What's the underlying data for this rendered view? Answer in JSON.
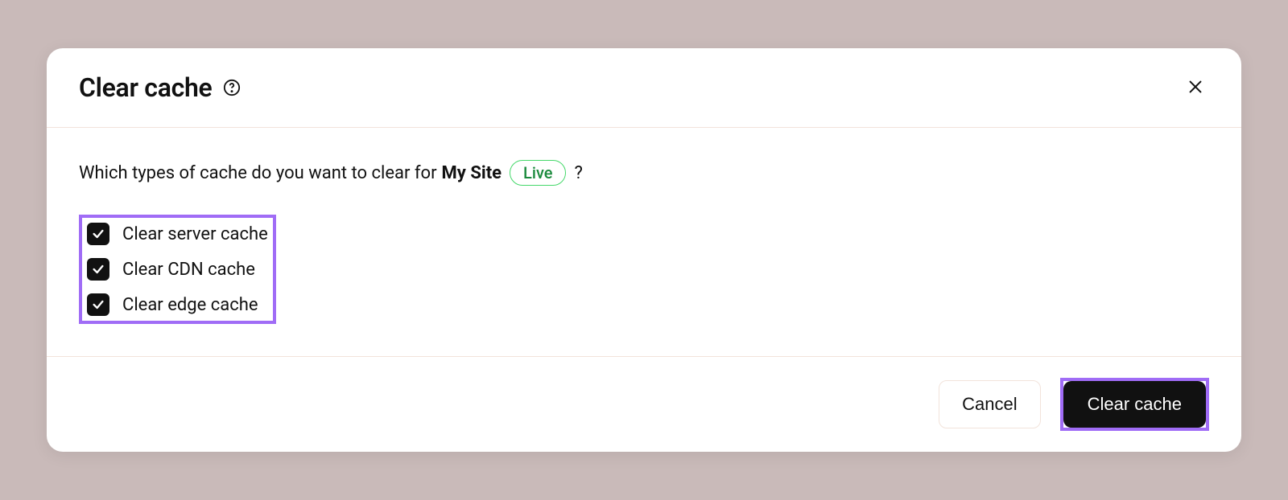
{
  "modal": {
    "title": "Clear cache",
    "prompt_prefix": "Which types of cache do you want to clear for",
    "site_name": "My Site",
    "badge": "Live",
    "prompt_suffix": "?",
    "options": [
      {
        "label": "Clear server cache",
        "checked": true
      },
      {
        "label": "Clear CDN cache",
        "checked": true
      },
      {
        "label": "Clear edge cache",
        "checked": true
      }
    ],
    "footer": {
      "cancel_label": "Cancel",
      "submit_label": "Clear cache"
    }
  }
}
